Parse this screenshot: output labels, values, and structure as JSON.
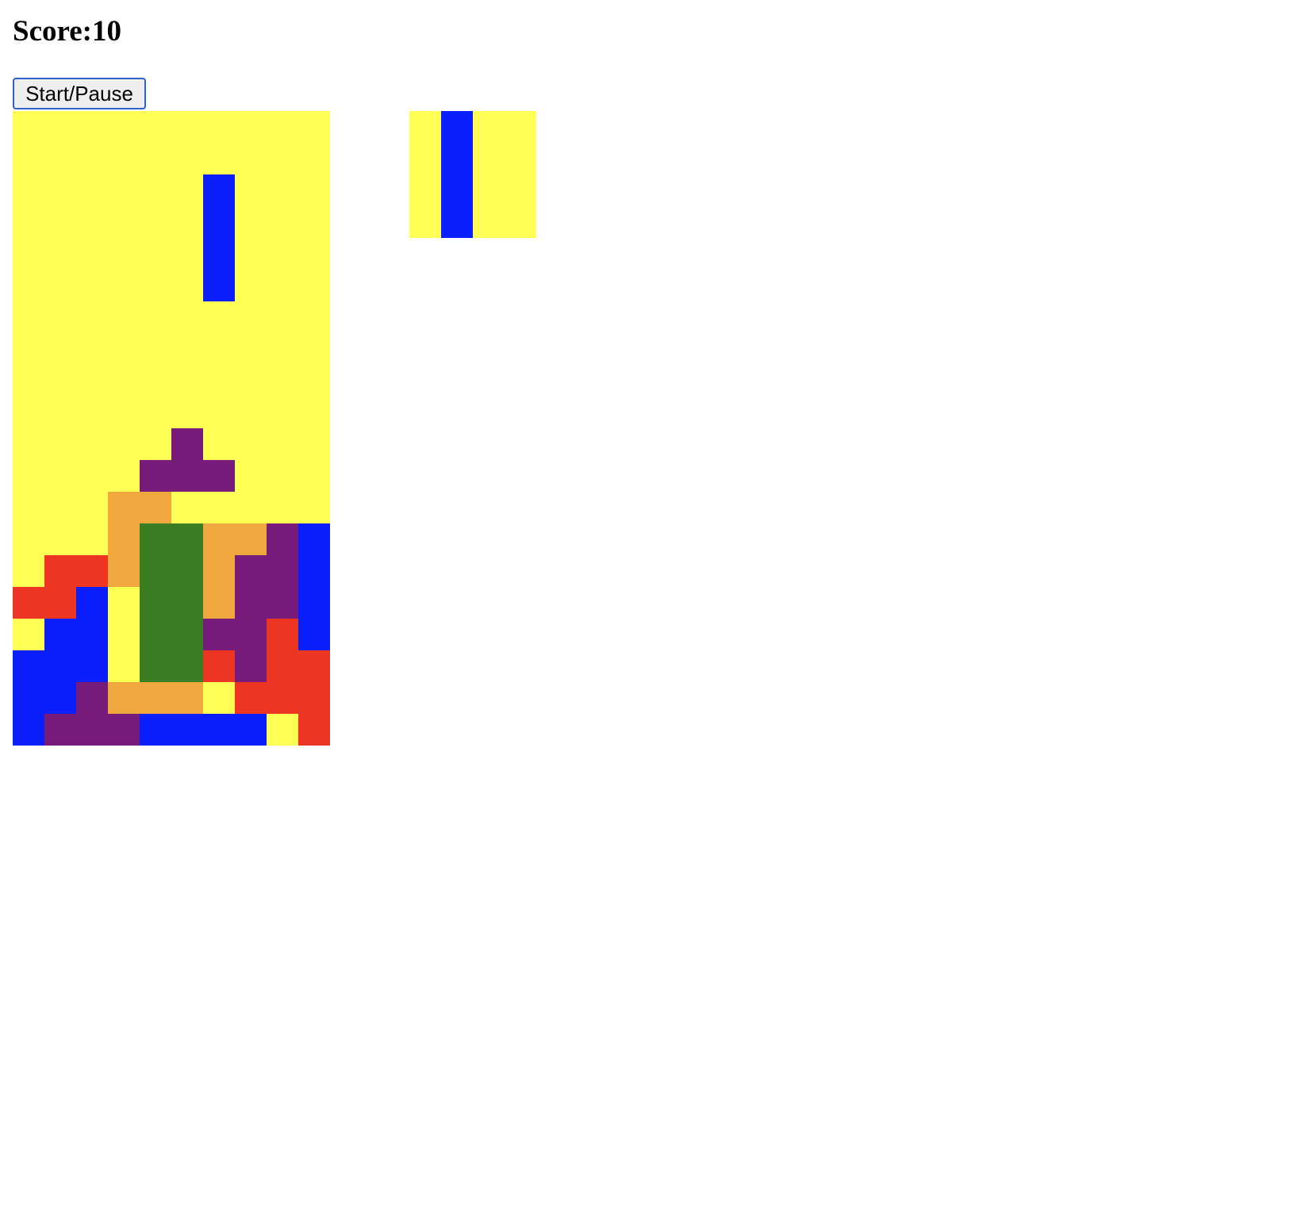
{
  "score": {
    "label": "Score:10",
    "value": 10
  },
  "controls": {
    "start_pause_label": "Start/Pause"
  },
  "colors": {
    "Y": "#ffff55",
    "B": "#0a1ffa",
    "P": "#761b7a",
    "O": "#f0a83e",
    "G": "#3a7d22",
    "R": "#ed3524"
  },
  "color_names": {
    "Y": "empty",
    "B": "blue",
    "P": "purple",
    "O": "orange",
    "G": "green",
    "R": "red"
  },
  "board": {
    "columns": 10,
    "rows_count": 20,
    "rows": [
      "YYYYYYYYYY",
      "YYYYYYYYYY",
      "YYYYYYBYYY",
      "YYYYYYBYYY",
      "YYYYYYBYYY",
      "YYYYYYBYYY",
      "YYYYYYYYYY",
      "YYYYYYYYYY",
      "YYYYYYYYYY",
      "YYYYYYYYYY",
      "YYYYYPYYYY",
      "YYYYPPPYYY",
      "YYYOOYYYYY",
      "YYYOGGOOPB",
      "YRROGGOPPB",
      "RRBYGGOPPB",
      "YBBYGGPPRB",
      "BBBYGGRPRR",
      "BBPOOOYRRR",
      "BPPPBBBBYR"
    ]
  },
  "next_piece": {
    "columns": 4,
    "rows_count": 4,
    "rows": [
      "YBYY",
      "YBYY",
      "YBYY",
      "YBYY"
    ]
  }
}
